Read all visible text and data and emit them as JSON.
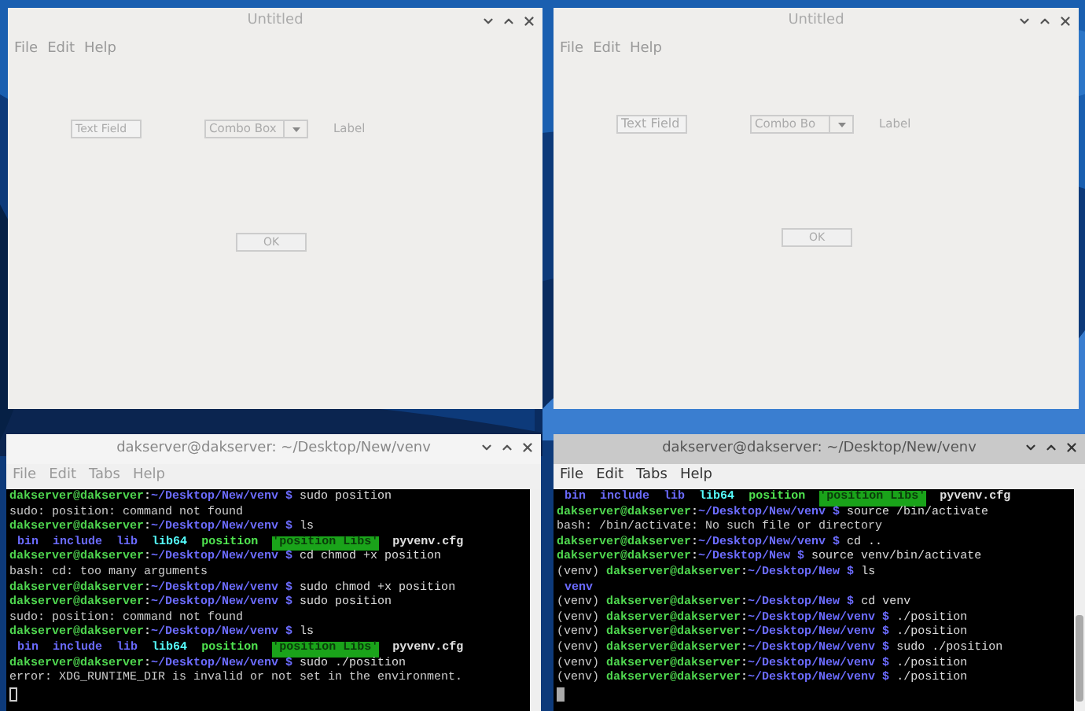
{
  "windows": [
    {
      "title": "Untitled",
      "menu": [
        "File",
        "Edit",
        "Help"
      ],
      "text_field": {
        "value": "Text Field"
      },
      "combo_box": {
        "value": "Combo Box"
      },
      "label": "Label",
      "button": "OK"
    },
    {
      "title": "Untitled",
      "menu": [
        "File",
        "Edit",
        "Help"
      ],
      "text_field": {
        "value": "Text Field"
      },
      "combo_box": {
        "value": "Combo Bo"
      },
      "label": "Label",
      "button": "OK"
    }
  ],
  "terminals": [
    {
      "title": "dakserver@dakserver: ~/Desktop/New/venv",
      "active": false,
      "menu": [
        "File",
        "Edit",
        "Tabs",
        "Help"
      ],
      "lines": [
        {
          "kind": "prompt",
          "user": "dakserver@dakserver",
          "sep": ":",
          "path": "~/Desktop/New/venv $",
          "command": "sudo position"
        },
        {
          "kind": "output",
          "text": "sudo: position: command not found"
        },
        {
          "kind": "prompt",
          "user": "dakserver@dakserver",
          "sep": ":",
          "path": "~/Desktop/New/venv $",
          "command": "ls"
        },
        {
          "kind": "listing",
          "entries": [
            {
              "name": "bin",
              "kind": "dir"
            },
            {
              "name": "include",
              "kind": "dir"
            },
            {
              "name": "lib",
              "kind": "dir"
            },
            {
              "name": "lib64",
              "kind": "link"
            },
            {
              "name": "position",
              "kind": "exec"
            },
            {
              "name": "'position Libs'",
              "kind": "shared"
            },
            {
              "name": "pyvenv.cfg",
              "kind": "file"
            }
          ]
        },
        {
          "kind": "prompt",
          "user": "dakserver@dakserver",
          "sep": ":",
          "path": "~/Desktop/New/venv $",
          "command": "cd chmod +x position"
        },
        {
          "kind": "output",
          "text": "bash: cd: too many arguments"
        },
        {
          "kind": "prompt",
          "user": "dakserver@dakserver",
          "sep": ":",
          "path": "~/Desktop/New/venv $",
          "command": "sudo chmod +x position"
        },
        {
          "kind": "prompt",
          "user": "dakserver@dakserver",
          "sep": ":",
          "path": "~/Desktop/New/venv $",
          "command": "sudo position"
        },
        {
          "kind": "output",
          "text": "sudo: position: command not found"
        },
        {
          "kind": "prompt",
          "user": "dakserver@dakserver",
          "sep": ":",
          "path": "~/Desktop/New/venv $",
          "command": "ls"
        },
        {
          "kind": "listing",
          "entries": [
            {
              "name": "bin",
              "kind": "dir"
            },
            {
              "name": "include",
              "kind": "dir"
            },
            {
              "name": "lib",
              "kind": "dir"
            },
            {
              "name": "lib64",
              "kind": "link"
            },
            {
              "name": "position",
              "kind": "exec"
            },
            {
              "name": "'position Libs'",
              "kind": "shared"
            },
            {
              "name": "pyvenv.cfg",
              "kind": "file"
            }
          ]
        },
        {
          "kind": "prompt",
          "user": "dakserver@dakserver",
          "sep": ":",
          "path": "~/Desktop/New/venv $",
          "command": "sudo ./position"
        },
        {
          "kind": "output",
          "text": "error: XDG_RUNTIME_DIR is invalid or not set in the environment."
        },
        {
          "kind": "cursor"
        }
      ]
    },
    {
      "title": "dakserver@dakserver: ~/Desktop/New/venv",
      "active": true,
      "menu": [
        "File",
        "Edit",
        "Tabs",
        "Help"
      ],
      "lines": [
        {
          "kind": "listing",
          "entries": [
            {
              "name": "bin",
              "kind": "dir"
            },
            {
              "name": "include",
              "kind": "dir"
            },
            {
              "name": "lib",
              "kind": "dir"
            },
            {
              "name": "lib64",
              "kind": "link"
            },
            {
              "name": "position",
              "kind": "exec"
            },
            {
              "name": "'position Libs'",
              "kind": "shared"
            },
            {
              "name": "pyvenv.cfg",
              "kind": "file"
            }
          ]
        },
        {
          "kind": "prompt",
          "user": "dakserver@dakserver",
          "sep": ":",
          "path": "~/Desktop/New/venv $",
          "command": "source /bin/activate"
        },
        {
          "kind": "output",
          "text": "bash: /bin/activate: No such file or directory"
        },
        {
          "kind": "prompt",
          "user": "dakserver@dakserver",
          "sep": ":",
          "path": "~/Desktop/New/venv $",
          "command": "cd .."
        },
        {
          "kind": "prompt",
          "user": "dakserver@dakserver",
          "sep": ":",
          "path": "~/Desktop/New $",
          "command": "source venv/bin/activate"
        },
        {
          "kind": "prompt",
          "prefix": "(venv)",
          "user": "dakserver@dakserver",
          "sep": ":",
          "path": "~/Desktop/New $",
          "command": "ls"
        },
        {
          "kind": "listing",
          "entries": [
            {
              "name": "venv",
              "kind": "dir"
            }
          ]
        },
        {
          "kind": "prompt",
          "prefix": "(venv)",
          "user": "dakserver@dakserver",
          "sep": ":",
          "path": "~/Desktop/New $",
          "command": "cd venv"
        },
        {
          "kind": "prompt",
          "prefix": "(venv)",
          "user": "dakserver@dakserver",
          "sep": ":",
          "path": "~/Desktop/New/venv $",
          "command": "./position"
        },
        {
          "kind": "prompt",
          "prefix": "(venv)",
          "user": "dakserver@dakserver",
          "sep": ":",
          "path": "~/Desktop/New/venv $",
          "command": "./position"
        },
        {
          "kind": "prompt",
          "prefix": "(venv)",
          "user": "dakserver@dakserver",
          "sep": ":",
          "path": "~/Desktop/New/venv $",
          "command": "sudo ./position"
        },
        {
          "kind": "prompt",
          "prefix": "(venv)",
          "user": "dakserver@dakserver",
          "sep": ":",
          "path": "~/Desktop/New/venv $",
          "command": "./position"
        },
        {
          "kind": "prompt",
          "prefix": "(venv)",
          "user": "dakserver@dakserver",
          "sep": ":",
          "path": "~/Desktop/New/venv $",
          "command": "./position"
        },
        {
          "kind": "cursor"
        }
      ]
    }
  ]
}
